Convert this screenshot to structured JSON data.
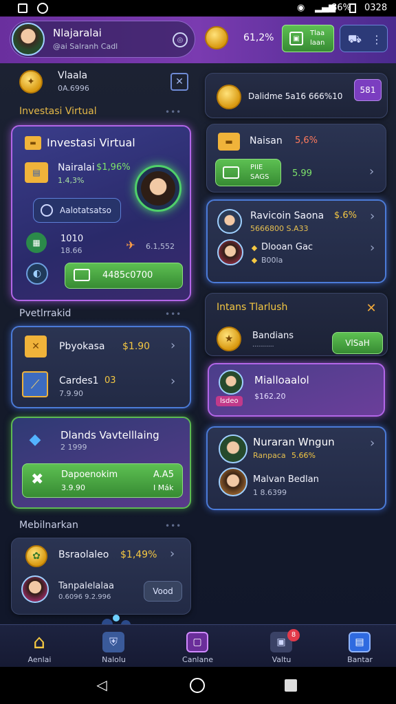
{
  "status_bar": {
    "battery": "86%",
    "time": "0328"
  },
  "header": {
    "user_name": "Nlajaralai",
    "user_handle": "@ai Salranh Cadl",
    "balance": "61,2%",
    "action_button": {
      "line1": "Tlaa",
      "line2": "laan"
    }
  },
  "left": {
    "profile": {
      "name": "Vlaala",
      "sub": "0A.6996"
    },
    "section1_title": "Investasi Virtual",
    "invest_card": {
      "title": "Investasi Virtual",
      "asset_name": "Nairalai",
      "asset_value": "$1,96%",
      "asset_change": "1.4,3%",
      "search_button": "Aalotatsatso",
      "stat_label": "1010",
      "stat_value": "18.66",
      "stat_right": "6.1,552",
      "cta": "4485c0700"
    },
    "section2_title": "Pvetlrrakid",
    "list1": [
      {
        "title": "Pbyokasa",
        "value": "$1.90",
        "sub": ""
      },
      {
        "title": "Cardes1",
        "value": "03",
        "sub": "7.9.90"
      }
    ],
    "promo": {
      "title": "Dlands Vavtelllaing",
      "sub": "2 1999",
      "inner_title": "Dapoenokim",
      "inner_sub": "3.9.90",
      "inner_right1": "A.A5",
      "inner_right2": "I Mák"
    },
    "section3_title": "Mebilnarkan",
    "list2": {
      "title": "Bsraolaleo",
      "value": "$1,49%",
      "person_name": "Tanpalelalaa",
      "person_sub": "0.6096 9.2.996",
      "button": "Vood"
    }
  },
  "right": {
    "coins_row": {
      "text": "Dalidme 5a16 666%10",
      "badge": "581"
    },
    "card_a": {
      "title": "Naisan",
      "value": "5,6%",
      "inner1": "PIIE",
      "inner2": "SAGS",
      "inner_value": "5.99"
    },
    "card_b": [
      {
        "title": "Ravicoin Saona",
        "value": "$.6%",
        "sub": "5666800 S.A33"
      },
      {
        "title": "Dlooan Gac",
        "sub": "B00la"
      }
    ],
    "section_title": "Intans Tlarlush",
    "reward": {
      "title": "Bandians",
      "sub": "...........",
      "button": "VlSaH"
    },
    "mid_card": {
      "title": "Mialloaalol",
      "tag": "lsdeo",
      "value": "$162.20"
    },
    "card_c": {
      "title": "Nuraran Wngun",
      "value": "5.66%",
      "sub_label": "Ranpaca",
      "name": "Malvan Bedlan",
      "sub": "1 8.6399"
    }
  },
  "nav": {
    "items": [
      "Aenlai",
      "Nalolu",
      "Canlane",
      "Valtu",
      "Bantar"
    ],
    "badge": "8"
  },
  "colors": {
    "accent_purple": "#7a3bb0",
    "accent_green": "#5dc052",
    "gold": "#f5c842"
  }
}
